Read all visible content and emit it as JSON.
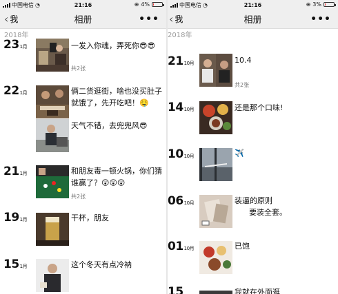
{
  "left": {
    "status": {
      "carrier": "中国电信",
      "time": "21:16",
      "battery": "4%",
      "battery_level": 0.04
    },
    "nav": {
      "back": "我",
      "title": "相册",
      "more": "•••"
    },
    "year": "2018年",
    "items": [
      {
        "day": "23",
        "month": "1月",
        "text": "一发入你魂，弄死你😎😎",
        "count": "共2张"
      },
      {
        "day": "22",
        "month": "1月",
        "text": "俩二货逛街，啥也没买肚子就饿了，先开吃吧！🤤"
      },
      {
        "text": "天气不错，去兜兜风😎"
      },
      {
        "day": "21",
        "month": "1月",
        "text": "和朋友毒一顿火锅，你们猜谁赢了？😲😲😲",
        "count": "共2张"
      },
      {
        "day": "19",
        "month": "1月",
        "text": "干杯，朋友"
      },
      {
        "day": "15",
        "month": "1月",
        "text": "这个冬天有点冷衲"
      }
    ]
  },
  "right": {
    "status": {
      "carrier": "中国电信",
      "time": "21:16",
      "battery": "3%",
      "battery_level": 0.03
    },
    "nav": {
      "back": "我",
      "title": "相册",
      "more": "•••"
    },
    "year": "2018年",
    "items": [
      {
        "day": "21",
        "month": "10月",
        "text": "10.4",
        "count": "共2张"
      },
      {
        "day": "14",
        "month": "10月",
        "text": "还是那个口味!"
      },
      {
        "day": "10",
        "month": "10月",
        "text": "✈️"
      },
      {
        "day": "06",
        "month": "10月",
        "text": "装逼的原则\n      要装全套。"
      },
      {
        "day": "01",
        "month": "10月",
        "text": "已饱"
      },
      {
        "day": "15",
        "month": "",
        "text": "我就在外面逛"
      }
    ]
  }
}
